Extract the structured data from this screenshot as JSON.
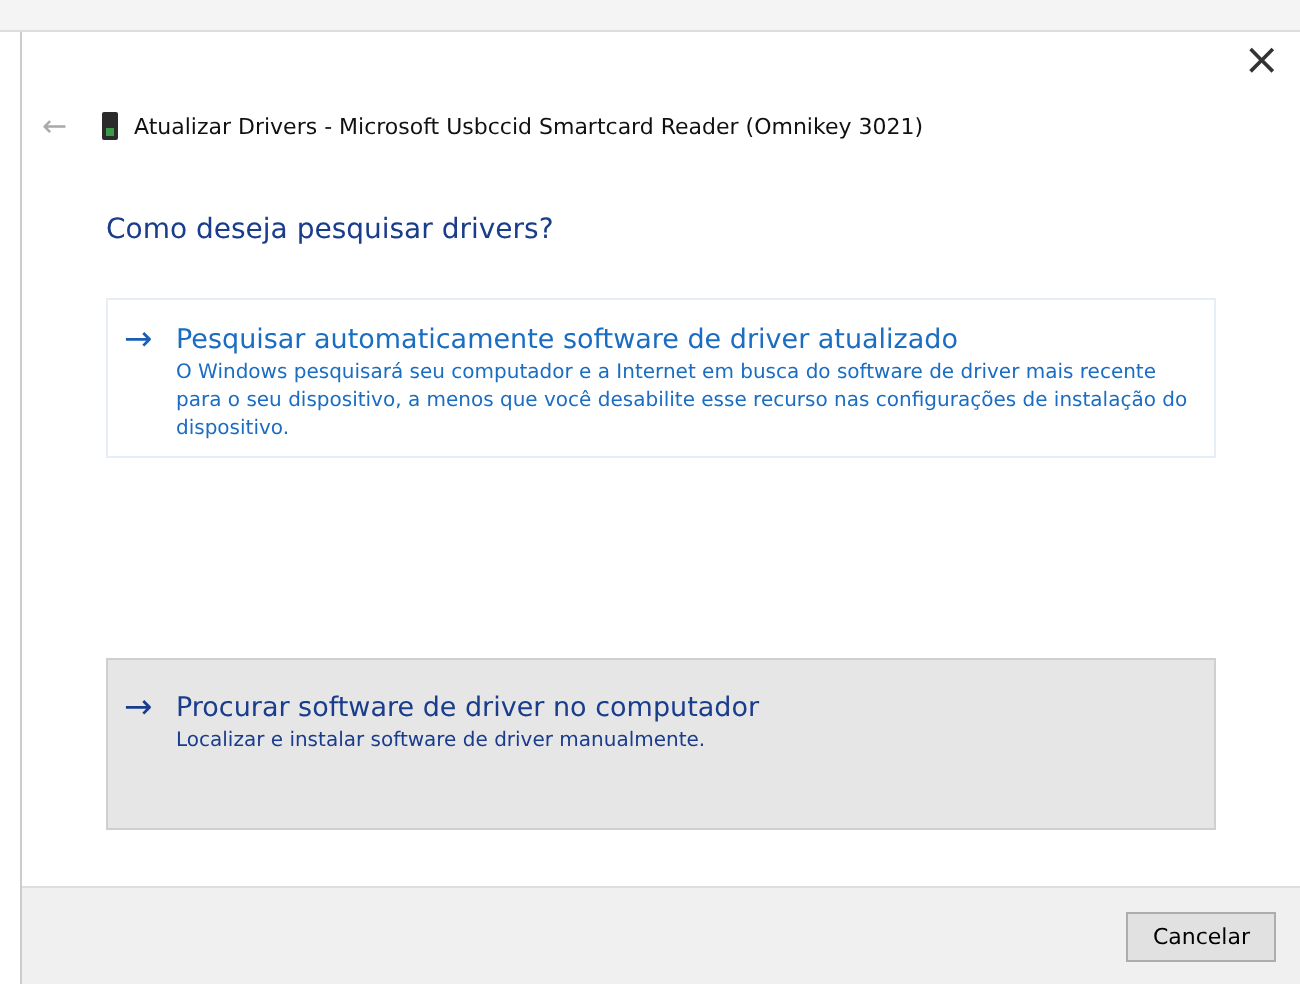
{
  "window": {
    "title": "Atualizar Drivers - Microsoft Usbccid Smartcard Reader (Omnikey 3021)",
    "close": "×",
    "back": "←"
  },
  "heading": "Como deseja pesquisar drivers?",
  "options": [
    {
      "arrow": "→",
      "title": "Pesquisar automaticamente software de driver atualizado",
      "description": "O Windows pesquisará seu computador e a Internet em busca do software de driver mais recente para o seu dispositivo, a menos que você desabilite esse recurso nas configurações de instalação do dispositivo.",
      "highlighted": false
    },
    {
      "arrow": "→",
      "title": "Procurar software de driver no computador",
      "description": "Localizar e instalar software de driver manualmente.",
      "highlighted": true
    }
  ],
  "buttons": [
    {
      "label": "Cancelar"
    }
  ]
}
